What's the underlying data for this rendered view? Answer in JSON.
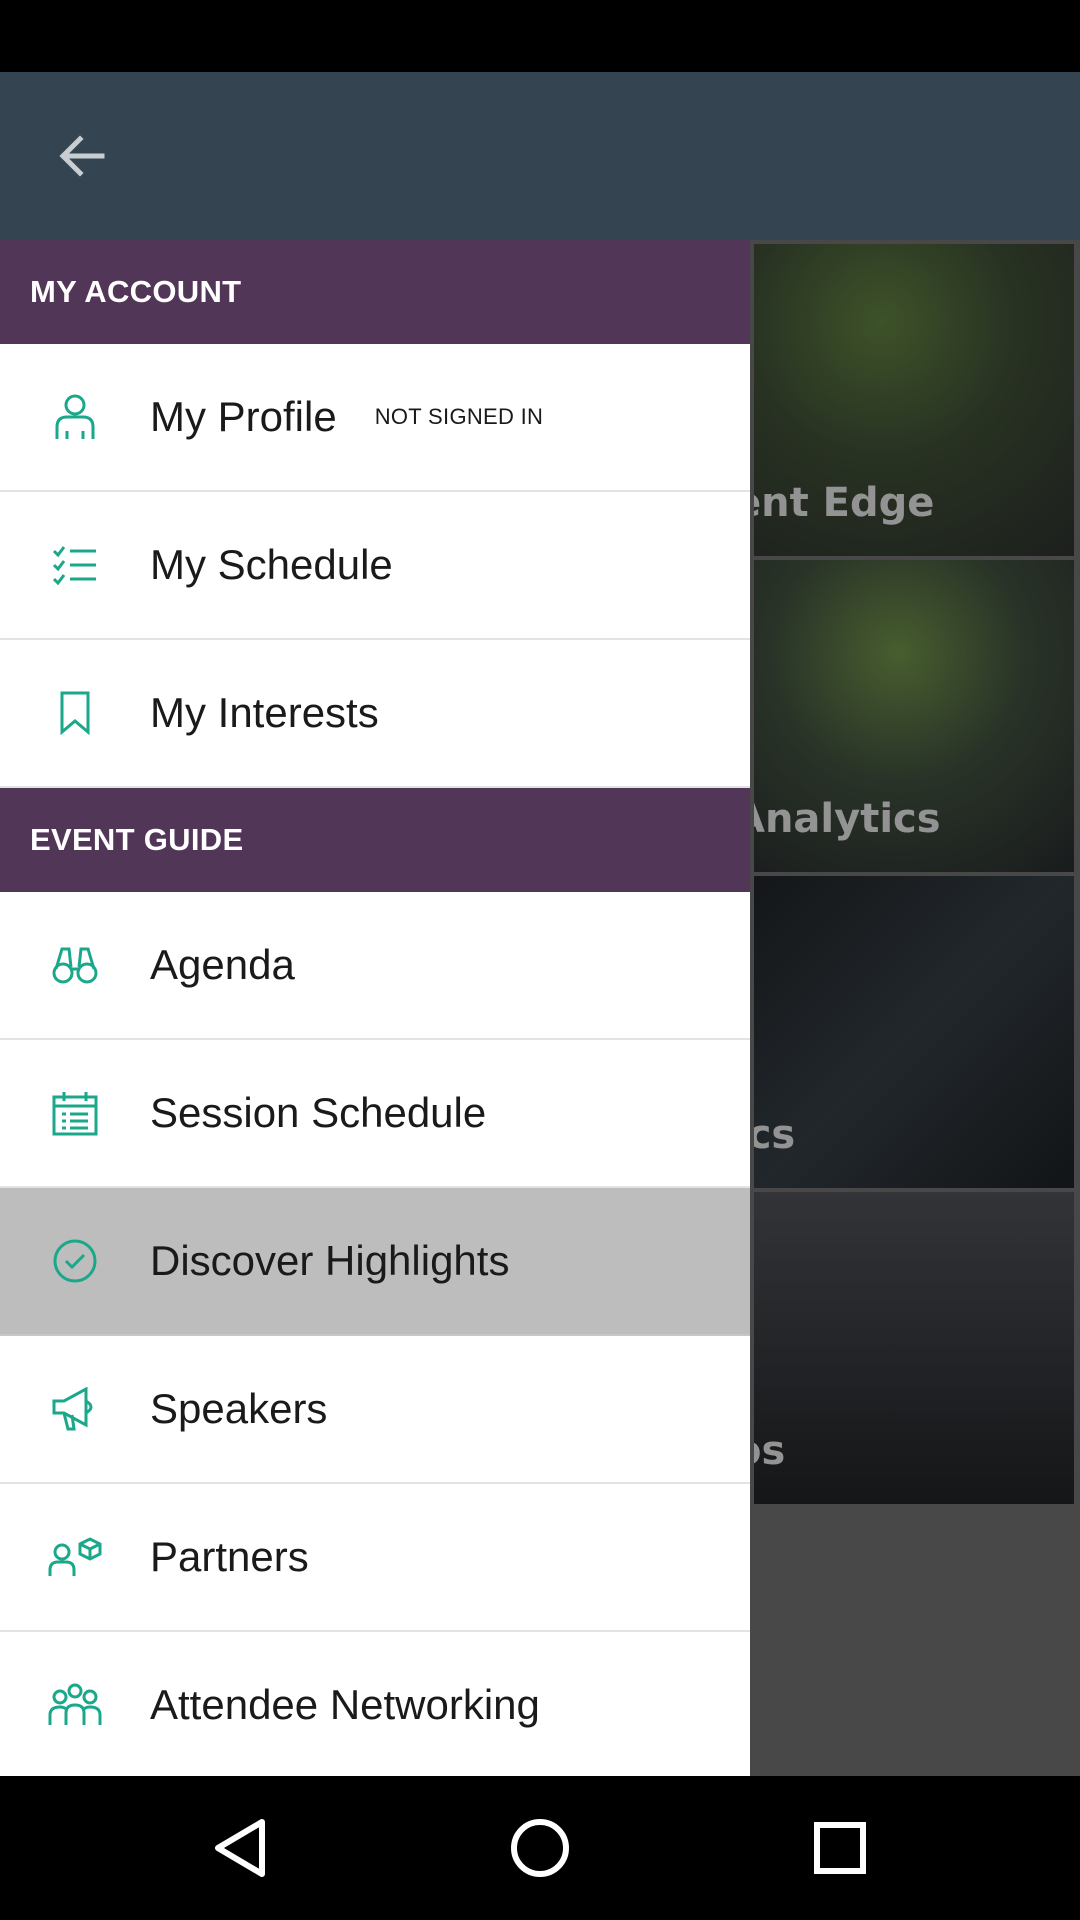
{
  "app_bar": {
    "back_icon": "arrow-left-icon"
  },
  "background_tiles": [
    {
      "title": "ent Edge"
    },
    {
      "title": "Analytics"
    },
    {
      "title": "ics"
    },
    {
      "title": "os"
    }
  ],
  "drawer": {
    "sections": [
      {
        "title": "MY ACCOUNT",
        "items": [
          {
            "label": "My Profile",
            "icon": "person-icon",
            "tag": "NOT SIGNED IN"
          },
          {
            "label": "My Schedule",
            "icon": "checklist-icon"
          },
          {
            "label": "My Interests",
            "icon": "bookmark-icon"
          }
        ]
      },
      {
        "title": "EVENT GUIDE",
        "items": [
          {
            "label": "Agenda",
            "icon": "binoculars-icon"
          },
          {
            "label": "Session Schedule",
            "icon": "calendar-icon"
          },
          {
            "label": "Discover Highlights",
            "icon": "check-circle-icon",
            "highlighted": true
          },
          {
            "label": "Speakers",
            "icon": "megaphone-icon"
          },
          {
            "label": "Partners",
            "icon": "partners-icon"
          },
          {
            "label": "Attendee Networking",
            "icon": "group-icon"
          }
        ]
      }
    ]
  },
  "colors": {
    "accent": "#1ba88a",
    "section_header": "#523658",
    "app_bar": "#344551",
    "highlight": "#bdbdbd"
  },
  "nav_bar": {
    "icons": [
      "nav-back-icon",
      "nav-home-icon",
      "nav-recents-icon"
    ]
  }
}
